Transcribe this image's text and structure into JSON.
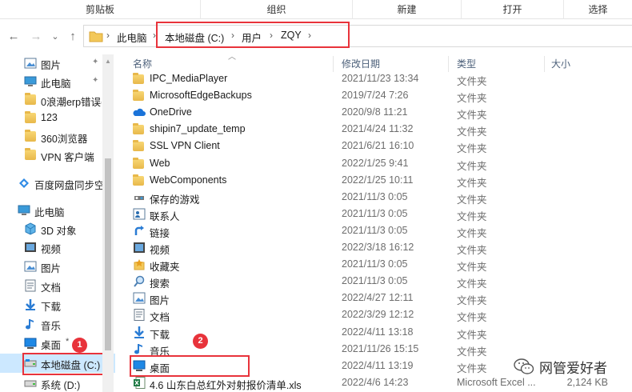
{
  "ribbon": {
    "groups": [
      "剪贴板",
      "组织",
      "新建",
      "打开",
      "选择"
    ]
  },
  "nav_buttons": {
    "back": "←",
    "forward": "→",
    "recent": "⌄",
    "up": "↑"
  },
  "address": {
    "crumbs": [
      "此电脑",
      "本地磁盘 (C:)",
      "用户",
      "ZQY"
    ],
    "sep": "›"
  },
  "sidebar": {
    "items": [
      {
        "label": "图片",
        "icon": "pictures-icon",
        "pinned": true
      },
      {
        "label": "此电脑",
        "icon": "computer-icon",
        "pinned": true
      },
      {
        "label": "0浪潮erp错误(",
        "icon": "folder-icon"
      },
      {
        "label": "123",
        "icon": "folder-icon"
      },
      {
        "label": "360浏览器",
        "icon": "folder-icon"
      },
      {
        "label": "VPN 客户端",
        "icon": "folder-icon"
      },
      {
        "label": "百度网盘同步空",
        "icon": "baidu-sync-icon"
      },
      {
        "label": "此电脑",
        "icon": "computer-icon"
      },
      {
        "label": "3D 对象",
        "icon": "3d-objects-icon"
      },
      {
        "label": "视频",
        "icon": "videos-icon"
      },
      {
        "label": "图片",
        "icon": "pictures-icon"
      },
      {
        "label": "文档",
        "icon": "documents-icon"
      },
      {
        "label": "下载",
        "icon": "downloads-icon"
      },
      {
        "label": "音乐",
        "icon": "music-icon"
      },
      {
        "label": "桌面",
        "icon": "desktop-icon"
      },
      {
        "label": "本地磁盘 (C:)",
        "icon": "drive-c-icon"
      },
      {
        "label": "系统 (D:)",
        "icon": "drive-d-icon"
      }
    ],
    "pin_glyph": "📌"
  },
  "columns": {
    "name": "名称",
    "date": "修改日期",
    "type": "类型",
    "size": "大小"
  },
  "files": [
    {
      "name": "IPC_MediaPlayer",
      "date": "2021/11/23 13:34",
      "type": "文件夹",
      "size": "",
      "icon": "folder-icon"
    },
    {
      "name": "MicrosoftEdgeBackups",
      "date": "2019/7/24 7:26",
      "type": "文件夹",
      "size": "",
      "icon": "folder-icon"
    },
    {
      "name": "OneDrive",
      "date": "2020/9/8 11:21",
      "type": "文件夹",
      "size": "",
      "icon": "onedrive-icon"
    },
    {
      "name": "shipin7_update_temp",
      "date": "2021/4/24 11:32",
      "type": "文件夹",
      "size": "",
      "icon": "folder-icon"
    },
    {
      "name": "SSL VPN Client",
      "date": "2021/6/21 16:10",
      "type": "文件夹",
      "size": "",
      "icon": "folder-icon"
    },
    {
      "name": "Web",
      "date": "2022/1/25 9:41",
      "type": "文件夹",
      "size": "",
      "icon": "folder-icon"
    },
    {
      "name": "WebComponents",
      "date": "2022/1/25 10:11",
      "type": "文件夹",
      "size": "",
      "icon": "folder-icon"
    },
    {
      "name": "保存的游戏",
      "date": "2021/11/3 0:05",
      "type": "文件夹",
      "size": "",
      "icon": "saved-games-icon"
    },
    {
      "name": "联系人",
      "date": "2021/11/3 0:05",
      "type": "文件夹",
      "size": "",
      "icon": "contacts-icon"
    },
    {
      "name": "链接",
      "date": "2021/11/3 0:05",
      "type": "文件夹",
      "size": "",
      "icon": "links-icon"
    },
    {
      "name": "视频",
      "date": "2022/3/18 16:12",
      "type": "文件夹",
      "size": "",
      "icon": "videos-icon"
    },
    {
      "name": "收藏夹",
      "date": "2021/11/3 0:05",
      "type": "文件夹",
      "size": "",
      "icon": "favorites-icon"
    },
    {
      "name": "搜索",
      "date": "2021/11/3 0:05",
      "type": "文件夹",
      "size": "",
      "icon": "search-icon"
    },
    {
      "name": "图片",
      "date": "2022/4/27 12:11",
      "type": "文件夹",
      "size": "",
      "icon": "pictures-icon"
    },
    {
      "name": "文档",
      "date": "2022/3/29 12:12",
      "type": "文件夹",
      "size": "",
      "icon": "documents-icon"
    },
    {
      "name": "下载",
      "date": "2022/4/11 13:18",
      "type": "文件夹",
      "size": "",
      "icon": "downloads-icon"
    },
    {
      "name": "音乐",
      "date": "2021/11/26 15:15",
      "type": "文件夹",
      "size": "",
      "icon": "music-icon"
    },
    {
      "name": "桌面",
      "date": "2022/4/11 13:19",
      "type": "文件夹",
      "size": "",
      "icon": "desktop-icon"
    },
    {
      "name": "4.6 山东白总红外对射报价清单.xls",
      "date": "2022/4/6 14:23",
      "type": "Microsoft Excel ...",
      "size": "2,124 KB",
      "icon": "excel-file-icon"
    }
  ],
  "annotations": {
    "badge1": "1",
    "badge2": "2",
    "highlight_color": "#e8333b"
  },
  "watermark": {
    "text": "网管爱好者"
  },
  "colors": {
    "selection": "#cce8ff",
    "header_text": "#4c607a",
    "folder": "#e8b84a"
  }
}
